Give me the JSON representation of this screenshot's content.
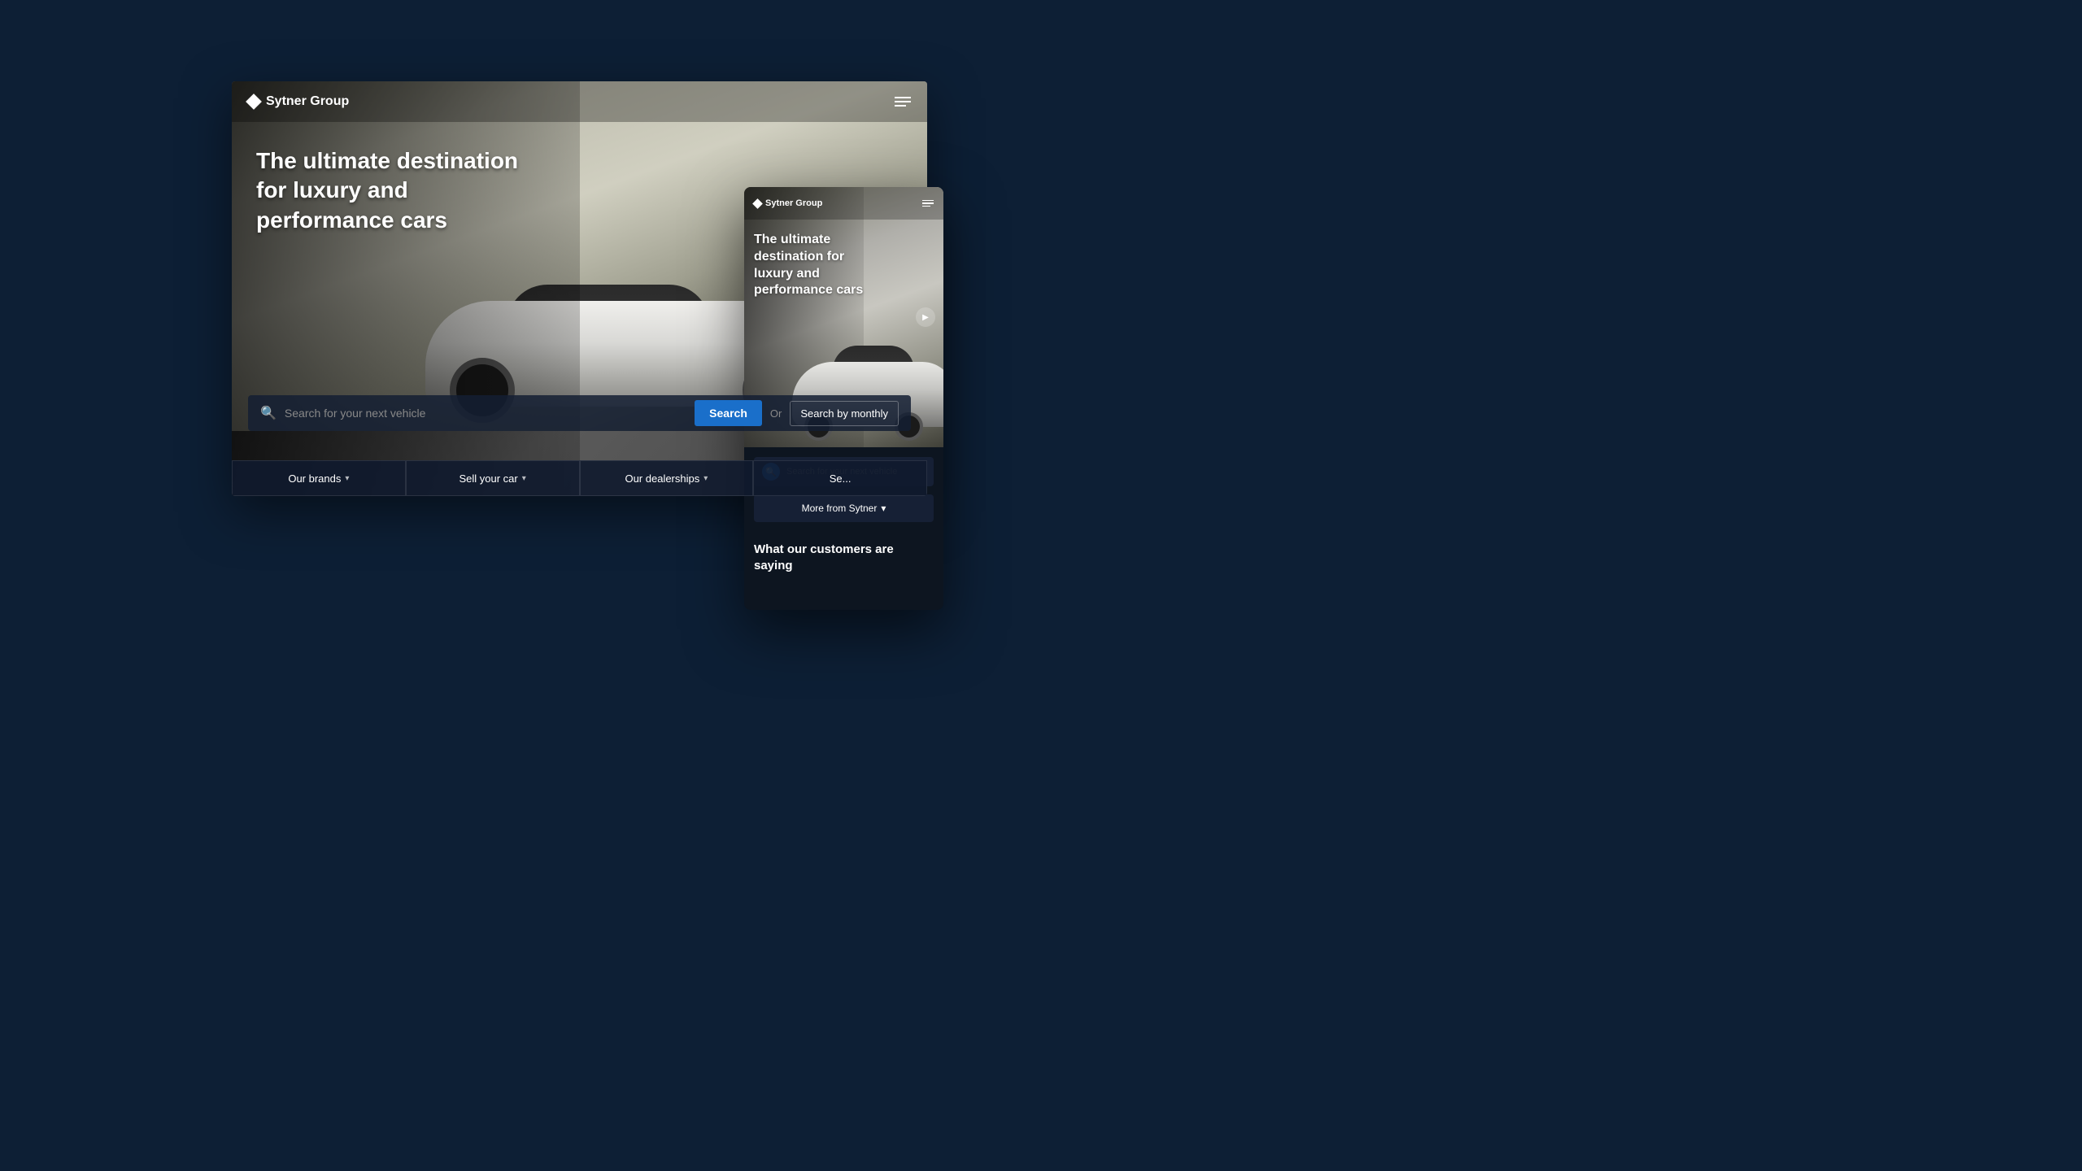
{
  "page": {
    "background_color": "#0d1f35"
  },
  "main_window": {
    "navbar": {
      "logo_text": "Sytner Group",
      "menu_icon_label": "menu"
    },
    "hero": {
      "title": "The ultimate destination for luxury and performance cars",
      "car_alt": "White sports car on wet road"
    },
    "search": {
      "placeholder": "Search for your next vehicle",
      "button_label": "Search",
      "or_text": "Or",
      "monthly_button_label": "Search by monthly"
    },
    "nav_links": [
      {
        "label": "Our brands",
        "has_chevron": true
      },
      {
        "label": "Sell your car",
        "has_chevron": true
      },
      {
        "label": "Our dealerships",
        "has_chevron": true
      },
      {
        "label": "Se...",
        "has_chevron": false
      }
    ]
  },
  "mobile_window": {
    "navbar": {
      "logo_text": "Sytner Group",
      "menu_icon_label": "menu"
    },
    "hero": {
      "title": "The ultimate destination for luxury and performance cars",
      "play_button_label": "play"
    },
    "search": {
      "placeholder": "Search for your next vehicle",
      "more_button_label": "More from Sytner",
      "more_chevron": "▾"
    },
    "bottom_section": {
      "title": "What our customers are saying"
    }
  },
  "icons": {
    "search": "🔍",
    "chevron_down": "▾",
    "play": "▶",
    "menu": "☰",
    "diamond": "◆"
  }
}
